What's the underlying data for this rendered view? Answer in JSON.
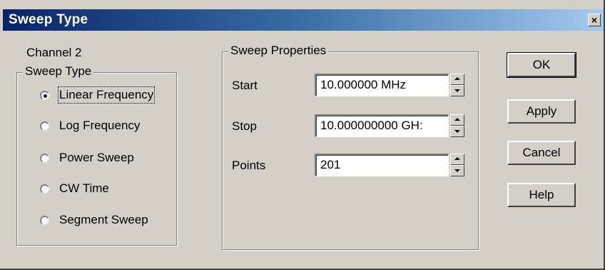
{
  "window": {
    "title": "Sweep Type",
    "close_glyph": "×"
  },
  "channel_label": "Channel 2",
  "sweep_type": {
    "group_label": "Sweep Type",
    "options": [
      {
        "label": "Linear Frequency",
        "checked": true
      },
      {
        "label": "Log Frequency",
        "checked": false
      },
      {
        "label": "Power Sweep",
        "checked": false
      },
      {
        "label": "CW Time",
        "checked": false
      },
      {
        "label": "Segment Sweep",
        "checked": false
      }
    ]
  },
  "sweep_properties": {
    "group_label": "Sweep Properties",
    "start": {
      "label": "Start",
      "value": "10.000000 MHz"
    },
    "stop": {
      "label": "Stop",
      "value": "10.000000000 GH:"
    },
    "points": {
      "label": "Points",
      "value": "201"
    }
  },
  "buttons": {
    "ok": "OK",
    "apply": "Apply",
    "cancel": "Cancel",
    "help": "Help"
  },
  "colors": {
    "dialog_face": "#d4d0c8",
    "titlebar_start": "#0a246a",
    "titlebar_end": "#a6caf0"
  }
}
